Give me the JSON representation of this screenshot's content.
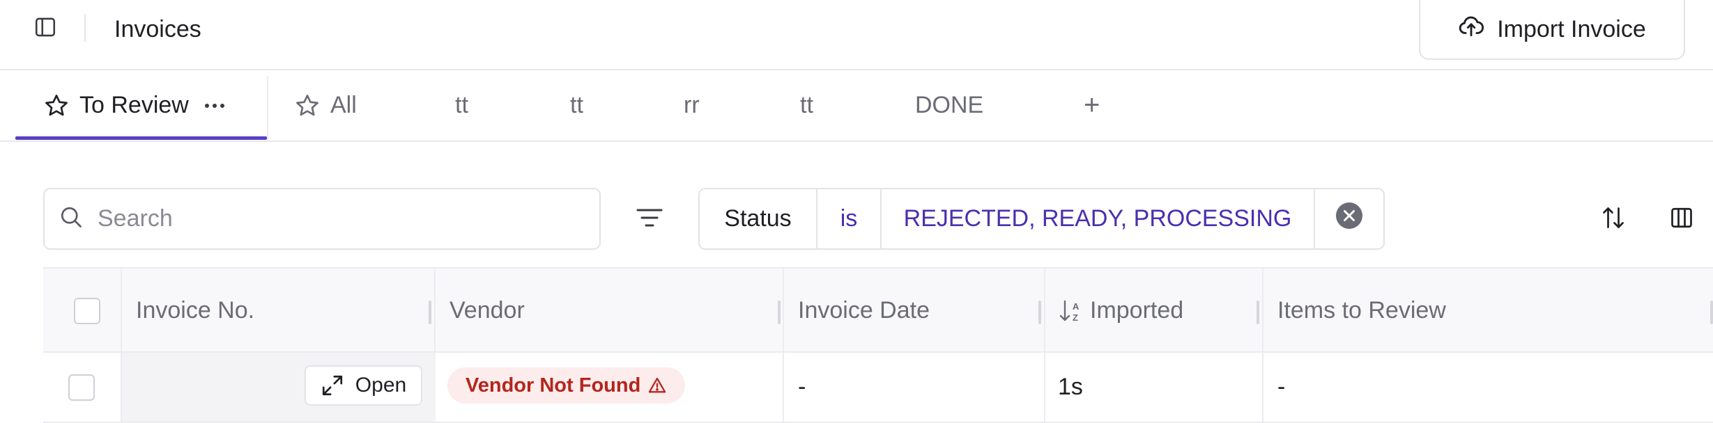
{
  "header": {
    "title": "Invoices",
    "import_label": "Import Invoice"
  },
  "tabs": [
    {
      "label": "To Review",
      "active": true,
      "starred": true
    },
    {
      "label": "All",
      "active": false,
      "starred": true
    },
    {
      "label": "tt",
      "active": false
    },
    {
      "label": "tt",
      "active": false
    },
    {
      "label": "rr",
      "active": false
    },
    {
      "label": "tt",
      "active": false
    },
    {
      "label": "DONE",
      "active": false
    }
  ],
  "add_tab_label": "+",
  "search": {
    "placeholder": "Search",
    "value": ""
  },
  "filter": {
    "field": "Status",
    "operator": "is",
    "value": "REJECTED, READY, PROCESSING"
  },
  "table": {
    "columns": [
      "Invoice No.",
      "Vendor",
      "Invoice Date",
      "Imported",
      "Items to Review"
    ],
    "sorted_column": "Imported",
    "rows": [
      {
        "invoice_no": "",
        "open_label": "Open",
        "vendor_status": "Vendor Not Found",
        "invoice_date": "-",
        "imported": "1s",
        "items_to_review": "-"
      }
    ]
  },
  "colors": {
    "accent": "#5b3fc7",
    "filter_text": "#4a2fb0",
    "danger_bg": "#fdecec",
    "danger_text": "#b3261e"
  },
  "icons": {
    "sidebar_toggle": "sidebar-panel-icon",
    "import": "cloud-upload-icon",
    "tab_star": "star-outline-icon",
    "tab_more": "more-horizontal-icon",
    "add_tab": "plus-icon",
    "search": "search-icon",
    "filter": "filter-lines-icon",
    "remove_filter": "close-circle-icon",
    "sort": "sort-arrows-icon",
    "columns": "columns-icon",
    "open": "expand-icon",
    "warning": "warning-triangle-icon",
    "sort_az": "sort-az-icon"
  }
}
